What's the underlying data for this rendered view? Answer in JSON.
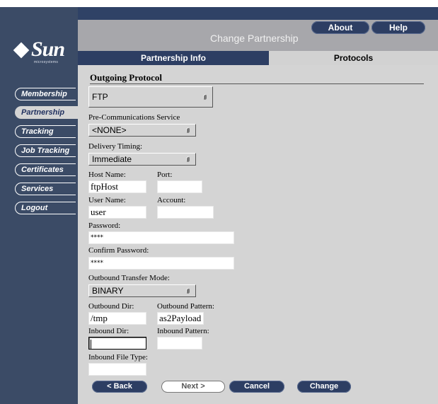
{
  "logo": {
    "brand": "Sun",
    "sub": "microsystems"
  },
  "header": {
    "title": "Change Partnership",
    "about_label": "About",
    "help_label": "Help"
  },
  "nav": {
    "items": [
      {
        "label": "Membership"
      },
      {
        "label": "Partnership",
        "active": true
      },
      {
        "label": "Tracking"
      },
      {
        "label": "Job Tracking"
      },
      {
        "label": "Certificates"
      },
      {
        "label": "Services"
      },
      {
        "label": "Logout"
      }
    ]
  },
  "tabs": {
    "partnership_info": "Partnership Info",
    "protocols": "Protocols"
  },
  "form": {
    "section_title": "Outgoing Protocol",
    "protocol": "FTP",
    "pre_comm_label": "Pre-Communications Service",
    "pre_comm_value": "<NONE>",
    "delivery_label": "Delivery Timing:",
    "delivery_value": "Immediate",
    "host_label": "Host Name:",
    "host_value": "ftpHost",
    "port_label": "Port:",
    "port_value": "",
    "user_label": "User Name:",
    "user_value": "user",
    "account_label": "Account:",
    "account_value": "",
    "password_label": "Password:",
    "password_value": "****",
    "confirm_label": "Confirm Password:",
    "confirm_value": "****",
    "transfer_label": "Outbound Transfer Mode:",
    "transfer_value": "BINARY",
    "out_dir_label": "Outbound Dir:",
    "out_dir_value": "/tmp",
    "out_pattern_label": "Outbound Pattern:",
    "out_pattern_value": "as2Payload",
    "in_dir_label": "Inbound Dir:",
    "in_dir_value": "",
    "in_pattern_label": "Inbound Pattern:",
    "in_pattern_value": "",
    "in_file_type_label": "Inbound File Type:",
    "in_file_type_value": ""
  },
  "buttons": {
    "back": "< Back",
    "next": "Next >",
    "cancel": "Cancel",
    "change": "Change"
  },
  "colors": {
    "nav_bg": "#3b4b66",
    "accent": "#2d3e63",
    "panel": "#d4d4d4",
    "header": "#a7a7ab"
  }
}
